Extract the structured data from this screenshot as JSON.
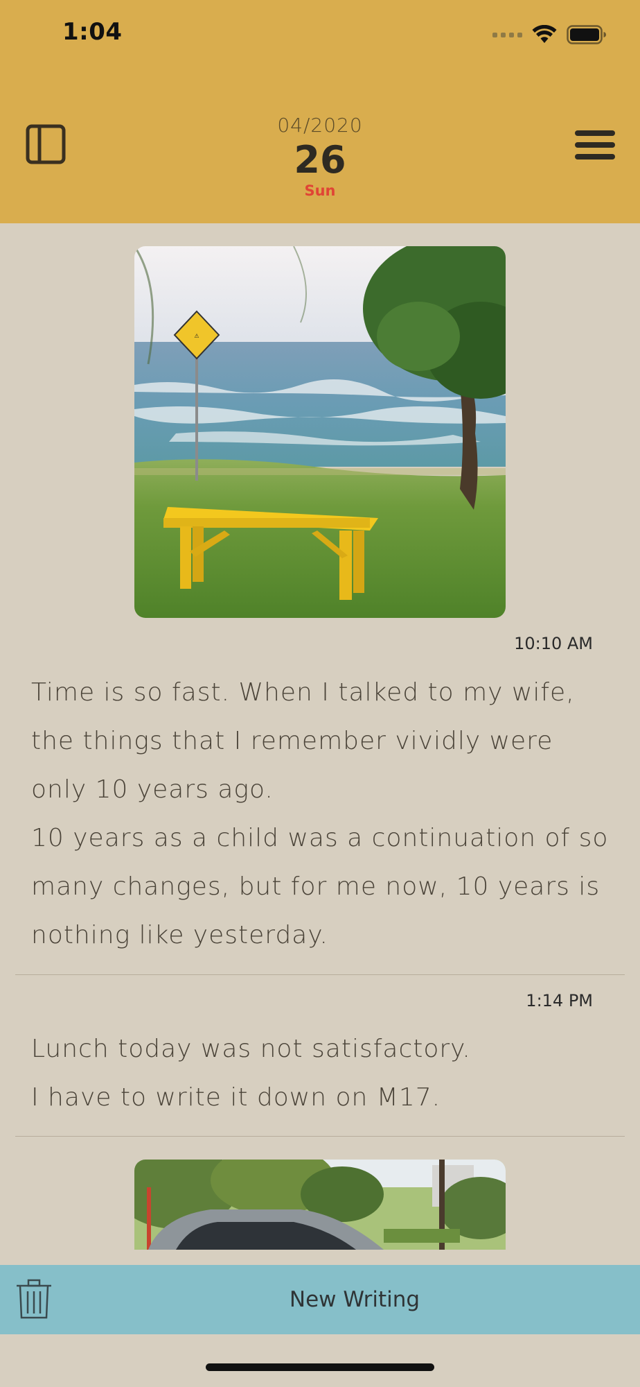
{
  "status_bar": {
    "time": "1:04",
    "icons": [
      "cellular-signal-icon",
      "wifi-icon",
      "battery-icon"
    ]
  },
  "header": {
    "left_icon": "sidebar-toggle-icon",
    "right_icon": "hamburger-menu-icon",
    "month_year": "04/2020",
    "day": "26",
    "weekday": "Sun",
    "colors": {
      "background": "#d9ad4e",
      "weekday": "#e04535"
    }
  },
  "entries": [
    {
      "photo": "ocean-bench-photo",
      "time": "10:10 AM",
      "paragraphs": [
        "Time is so fast. When I talked to my wife, the things that I remember vividly were only 10 years ago.",
        "10 years as a child was a continuation of so many changes, but for me now, 10 years is nothing like yesterday."
      ]
    },
    {
      "time": "1:14 PM",
      "paragraphs": [
        "Lunch today was not satisfactory.",
        "I have to write it down on M17."
      ]
    },
    {
      "photo": "parked-car-photo"
    }
  ],
  "bottom_bar": {
    "trash_icon": "trash-icon",
    "new_writing_label": "New Writing",
    "background": "#86bfc9"
  },
  "page_background": "#d7cfc0"
}
